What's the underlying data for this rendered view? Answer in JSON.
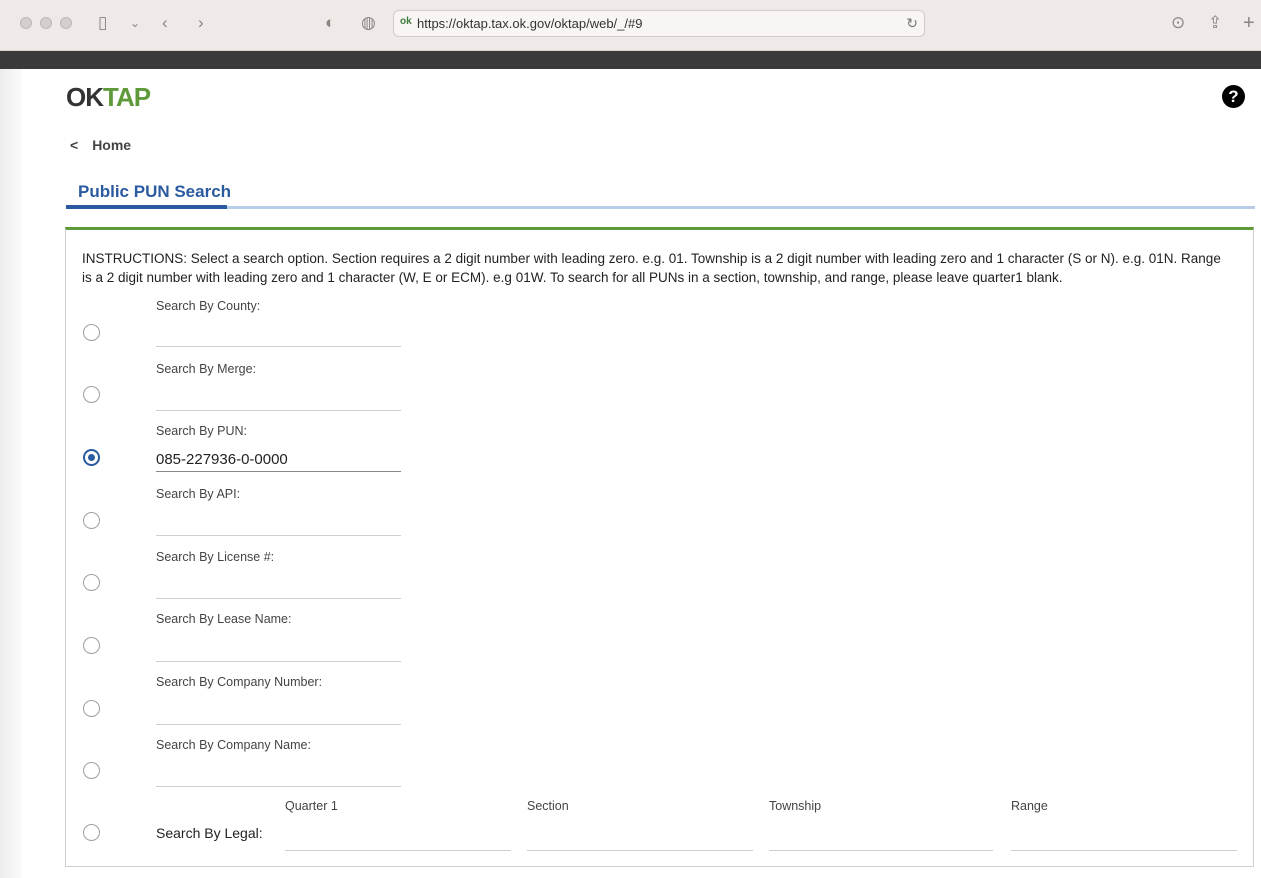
{
  "browser": {
    "url": "https://oktap.tax.ok.gov/oktap/web/_/#9"
  },
  "header": {
    "logo_ok": "OK",
    "logo_tap": "TAP",
    "help_symbol": "?",
    "breadcrumb_back": "<",
    "home_label": "Home"
  },
  "tab": {
    "title": "Public PUN Search"
  },
  "instructions": "INSTRUCTIONS: Select a search option. Section requires a 2 digit number with leading zero. e.g. 01. Township is a 2 digit number with leading zero and 1 character (S or N). e.g. 01N. Range is a 2 digit number with leading zero and 1 character (W, E or ECM). e.g 01W. To search for all PUNs in a section, township, and range, please leave quarter1 blank.",
  "search_options": [
    {
      "label": "Search By County:",
      "value": "",
      "selected": false
    },
    {
      "label": "Search By Merge:",
      "value": "",
      "selected": false
    },
    {
      "label": "Search By PUN:",
      "value": "085-227936-0-0000",
      "selected": true
    },
    {
      "label": "Search By API:",
      "value": "",
      "selected": false
    },
    {
      "label": "Search By License #:",
      "value": "",
      "selected": false
    },
    {
      "label": "Search By Lease Name:",
      "value": "",
      "selected": false
    },
    {
      "label": "Search By Company Number:",
      "value": "",
      "selected": false
    },
    {
      "label": "Search By Company Name:",
      "value": "",
      "selected": false
    }
  ],
  "legal_search": {
    "label": "Search By Legal:",
    "selected": false,
    "columns": [
      "Quarter 1",
      "Section",
      "Township",
      "Range"
    ]
  },
  "colors": {
    "brand_green": "#5f9a3a",
    "brand_blue": "#2a5aa0"
  }
}
